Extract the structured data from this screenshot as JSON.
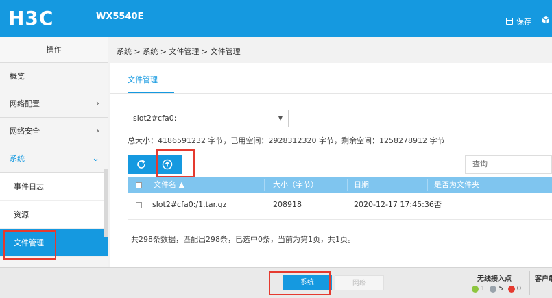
{
  "header": {
    "logo": "H3C",
    "model": "WX5540E",
    "save_label": "保存"
  },
  "sidebar": {
    "title": "操作",
    "items": [
      {
        "label": "概览",
        "arrow": ""
      },
      {
        "label": "网络配置",
        "arrow": "›"
      },
      {
        "label": "网络安全",
        "arrow": "›"
      },
      {
        "label": "系统",
        "arrow": "⌄"
      }
    ],
    "sub_items": [
      {
        "label": "事件日志"
      },
      {
        "label": "资源"
      },
      {
        "label": "文件管理"
      }
    ]
  },
  "breadcrumb": "系统 > 系统 > 文件管理 > 文件管理",
  "tab": "文件管理",
  "storage_select": "slot2#cfa0:",
  "sizes_text": "总大小：4186591232 字节，已用空间：2928312320 字节，剩余空间：1258278912 字节",
  "search_placeholder": "查询",
  "table": {
    "headers": [
      "文件名 ▲",
      "大小（字节）",
      "日期",
      "是否为文件夹"
    ],
    "rows": [
      [
        "slot2#cfa0:/1.tar.gz",
        "208918",
        "2020-12-17 17:45:36",
        "否"
      ]
    ]
  },
  "summary": "共298条数据，匹配出298条，已选中0条，当前为第1页，共1页。",
  "bottom": {
    "tab_active": "系统",
    "tab_inactive": "网络",
    "ap_title": "无线接入点",
    "ap_counts": [
      "1",
      "5",
      "0"
    ],
    "client_title": "客户端"
  },
  "colors": {
    "brand": "#1599e0",
    "header_row": "#7fc5ef",
    "highlight": "#e53a2f",
    "ok": "#8dc63f",
    "idle": "#9aa3ab",
    "alarm": "#e53a2f"
  }
}
